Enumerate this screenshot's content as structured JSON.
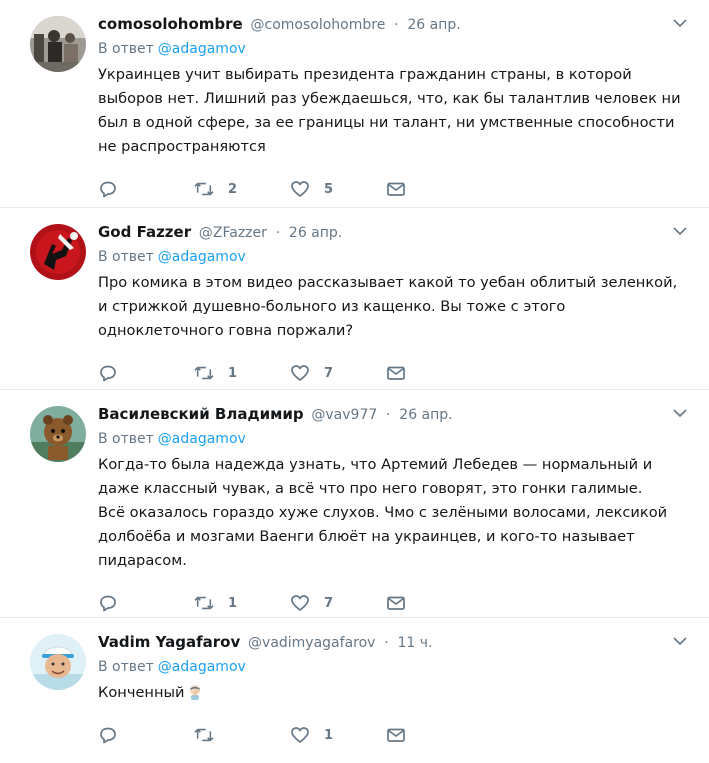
{
  "icons": {
    "reply": "reply-icon",
    "retweet": "retweet-icon",
    "like": "heart-icon",
    "dm": "envelope-icon",
    "caret": "chevron-down-icon"
  },
  "colors": {
    "link": "#1da1f2",
    "muted": "#657786",
    "text": "#14171a",
    "border": "#e6ecf0"
  },
  "tweets": [
    {
      "fullname": "comosolohombre",
      "username": "@comosolohombre",
      "dot": "·",
      "time": "26 апр.",
      "reply_prefix": "В ответ",
      "reply_to": "@adagamov",
      "text": "Украинцев учит выбирать президента гражданин страны, в которой выборов нет. Лишний раз убеждаешься, что, как бы талантлив человек ни был в одной сфере, за ее границы ни талант, ни умственные способности не распространяются",
      "retweets": "2",
      "likes": "5"
    },
    {
      "fullname": "God Fazzer",
      "username": "@ZFazzer",
      "dot": "·",
      "time": "26 апр.",
      "reply_prefix": "В ответ",
      "reply_to": "@adagamov",
      "text": "Про комика в этом видео рассказывает какой то уебан облитый зеленкой, и стрижкой душевно-больного из кащенко. Вы  тоже с этого одноклеточного говна поржали?",
      "retweets": "1",
      "likes": "7"
    },
    {
      "fullname": "Василевский Владимир",
      "username": "@vav977",
      "dot": "·",
      "time": "26 апр.",
      "reply_prefix": "В ответ",
      "reply_to": "@adagamov",
      "text": "Когда-то была надежда узнать, что Артемий Лебедев — нормальный и даже классный чувак, а всё что про него говорят, это гонки галимые.\nВсё оказалось гораздо хуже слухов. Чмо с зелёными волосами, лексикой долбоёба и мозгами Ваенги блюёт на украинцев, и кого-то называет пидарасом.",
      "retweets": "1",
      "likes": "7"
    },
    {
      "fullname": "Vadim Yagafarov",
      "username": "@vadimyagafarov",
      "dot": "·",
      "time": "11 ч.",
      "reply_prefix": "В ответ",
      "reply_to": "@adagamov",
      "text": "Конченный",
      "emoji": "facepalm-emoji",
      "retweets": "",
      "likes": "1"
    }
  ]
}
